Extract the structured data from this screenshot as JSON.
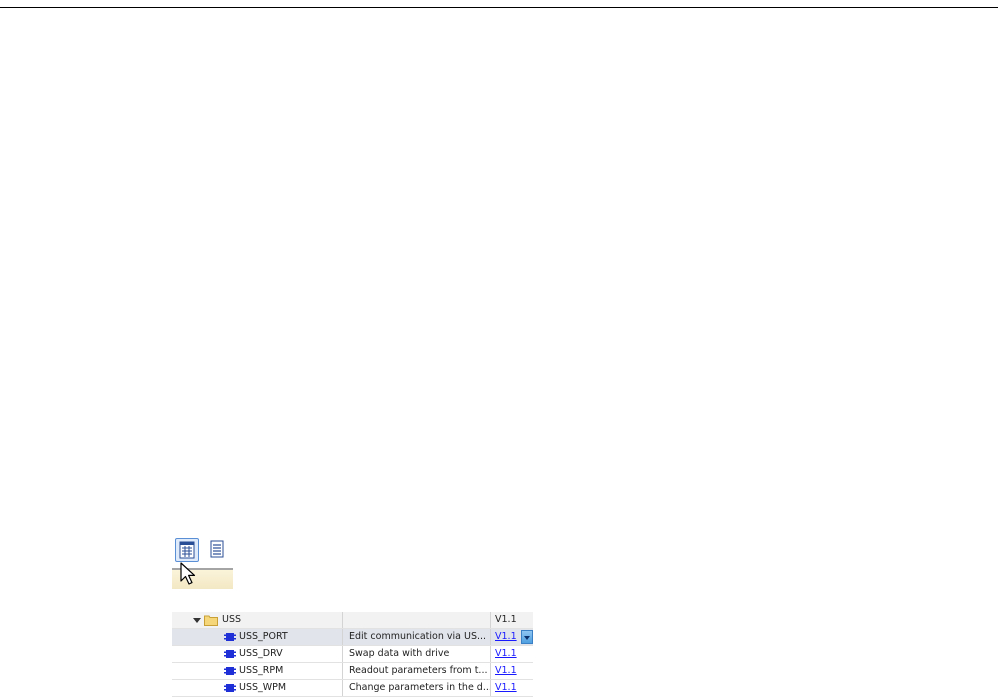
{
  "toolbar": {
    "buttons": [
      {
        "icon": "detail-view-icon",
        "active": true
      },
      {
        "icon": "list-view-icon",
        "active": false
      }
    ]
  },
  "library": {
    "folder": {
      "name": "USS",
      "version": "V1.1",
      "icon": "folder-icon",
      "expanded": true
    },
    "rows": [
      {
        "name": "USS_PORT",
        "description": "Edit communication via US...",
        "version": "V1.1",
        "selected": true
      },
      {
        "name": "USS_DRV",
        "description": "Swap data with drive",
        "version": "V1.1",
        "selected": false
      },
      {
        "name": "USS_RPM",
        "description": "Readout parameters from t...",
        "version": "V1.1",
        "selected": false
      },
      {
        "name": "USS_WPM",
        "description": "Change parameters in the d...",
        "version": "V1.1",
        "selected": false
      }
    ]
  },
  "colors": {
    "link": "#1a1aff",
    "selected_row": "#e1e4eb",
    "active_button_border": "#5a8fd6",
    "block_icon": "#1e2fd8"
  }
}
